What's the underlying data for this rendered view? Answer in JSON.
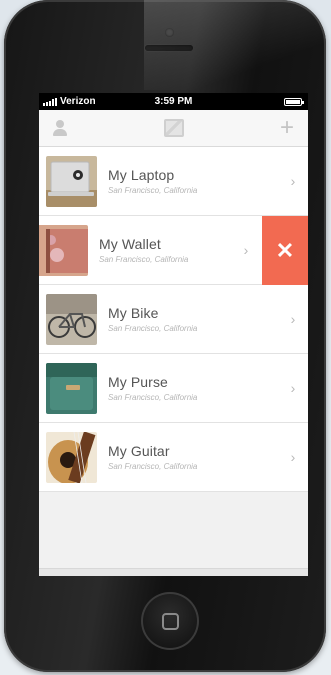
{
  "status_bar": {
    "carrier": "Verizon",
    "time": "3:59 PM",
    "battery_level": 1.0
  },
  "toolbar": {
    "left_icon": "person-icon",
    "center_icon": "map-icon",
    "right_icon": "plus-icon"
  },
  "items": [
    {
      "title": "My Laptop",
      "location": "San Francisco, California",
      "thumbnail": "laptop",
      "swiped": false
    },
    {
      "title": "My Wallet",
      "location": "San Francisco, California",
      "thumbnail": "wallet",
      "swiped": true
    },
    {
      "title": "My Bike",
      "location": "San Francisco, California",
      "thumbnail": "bike",
      "swiped": false
    },
    {
      "title": "My Purse",
      "location": "San Francisco, California",
      "thumbnail": "purse",
      "swiped": false
    },
    {
      "title": "My Guitar",
      "location": "San Francisco, California",
      "thumbnail": "guitar",
      "swiped": false
    }
  ],
  "colors": {
    "delete_action": "#f26a51",
    "title_text": "#555555",
    "subtitle_text": "#b5b5b5",
    "list_background": "#ffffff"
  }
}
